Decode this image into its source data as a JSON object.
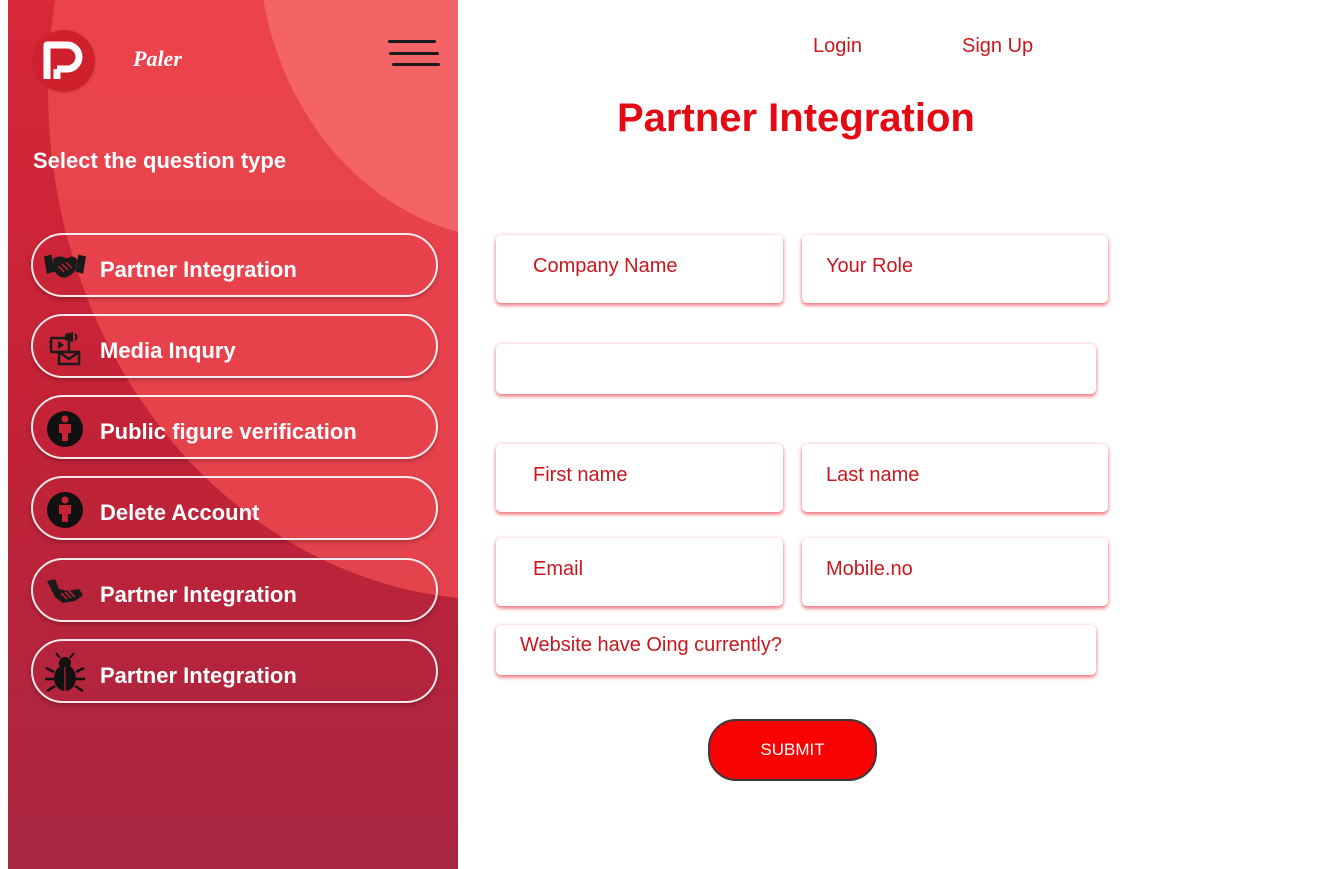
{
  "brand": {
    "name": "Paler"
  },
  "sidebar": {
    "heading": "Select the question type",
    "items": [
      {
        "label": "Partner Integration",
        "icon": "handshake-icon"
      },
      {
        "label": "Media Inqury",
        "icon": "media-icon"
      },
      {
        "label": "Public figure verification",
        "icon": "person-icon"
      },
      {
        "label": "Delete Account",
        "icon": "person-icon"
      },
      {
        "label": "Partner Integration",
        "icon": "handshake-icon"
      },
      {
        "label": "Partner Integration",
        "icon": "bug-icon"
      }
    ]
  },
  "header": {
    "login": "Login",
    "signup": "Sign Up"
  },
  "form": {
    "title": "Partner Integration",
    "company_name": "Company Name",
    "your_role": "Your Role",
    "blank_field": "",
    "first_name": "First name",
    "last_name": "Last name",
    "email": "Email",
    "mobile": "Mobile.no",
    "website_question": "Website have Oing currently?",
    "submit": "SUBMIT"
  },
  "colors": {
    "accent": "#e50914",
    "sidebar_top": "#d8283a",
    "sidebar_bottom": "#a82641",
    "submit_bg": "#fa0202"
  }
}
